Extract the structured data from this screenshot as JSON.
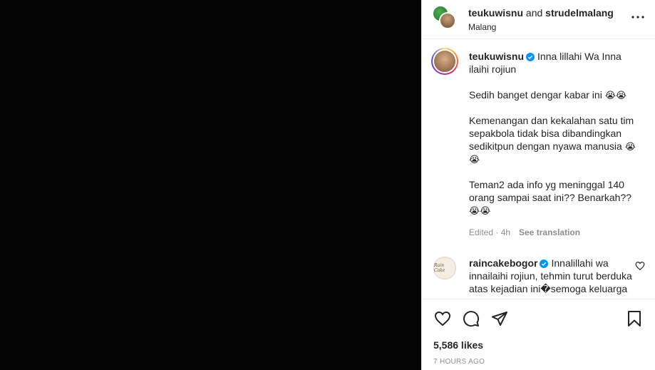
{
  "header": {
    "user1": "teukuwisnu",
    "and": "and",
    "user2": "strudelmalang",
    "location": "Malang",
    "more_icon": "more-horizontal-icon"
  },
  "caption": {
    "username": "teukuwisnu",
    "verified": true,
    "line1": "Inna lillahi Wa Inna ilaihi rojiun",
    "line2": "Sedih banget dengar kabar ini",
    "line3": "Kemenangan dan kekalahan satu tim sepakbola tidak bisa dibandingkan sedikitpun dengan nyawa manusia",
    "line4": "Teman2 ada info yg meninggal 140 orang sampai saat ini?? Benarkah??",
    "emoji": "😭",
    "edited": "Edited · 4h",
    "see_translation": "See translation"
  },
  "comment": {
    "username": "raincakebogor",
    "verified": true,
    "text": "Innalillahi wa innailaihi rojiun, tehmin turut berduka atas kejadian ini�semoga keluarga korban di beri ketabahan",
    "avatar_text": "Rain Cake"
  },
  "actions": {
    "like_icon": "heart-icon",
    "comment_icon": "comment-icon",
    "share_icon": "send-icon",
    "save_icon": "bookmark-icon",
    "likes": "5,586 likes",
    "time": "7 HOURS AGO"
  }
}
